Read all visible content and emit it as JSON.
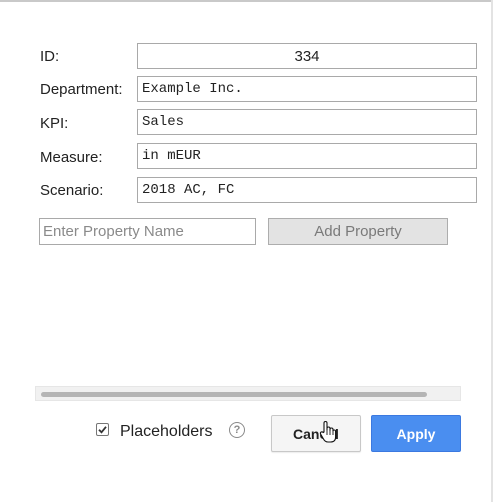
{
  "properties": [
    {
      "label": "ID:",
      "value": "334"
    },
    {
      "label": "Department:",
      "value": "Example Inc."
    },
    {
      "label": "KPI:",
      "value": "Sales"
    },
    {
      "label": "Measure:",
      "value": "in mEUR"
    },
    {
      "label": "Scenario:",
      "value": "2018 AC, FC"
    }
  ],
  "new_property": {
    "placeholder": "Enter Property Name",
    "button_label": "Add Property"
  },
  "footer": {
    "placeholders_label": "Placeholders",
    "placeholders_checked": true,
    "help_icon": "question-circle-icon",
    "cancel_label": "Cancel",
    "apply_label": "Apply"
  },
  "colors": {
    "apply_button": "#4a8ef0",
    "disabled_button": "#e3e3e3"
  }
}
